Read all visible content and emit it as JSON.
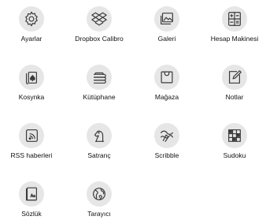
{
  "apps": [
    {
      "label": "Ayarlar",
      "icon": "gear-icon"
    },
    {
      "label": "Dropbox Calibro",
      "icon": "dropbox-icon"
    },
    {
      "label": "Galeri",
      "icon": "gallery-icon"
    },
    {
      "label": "Hesap Makinesi",
      "icon": "calculator-icon"
    },
    {
      "label": "Kosynka",
      "icon": "cards-icon"
    },
    {
      "label": "Kütüphane",
      "icon": "library-icon"
    },
    {
      "label": "Mağaza",
      "icon": "shopping-bag-icon"
    },
    {
      "label": "Notlar",
      "icon": "notepad-icon"
    },
    {
      "label": "RSS haberleri",
      "icon": "rss-icon"
    },
    {
      "label": "Satranç",
      "icon": "chess-knight-icon"
    },
    {
      "label": "Scribble",
      "icon": "scribble-icon"
    },
    {
      "label": "Sudoku",
      "icon": "sudoku-icon"
    },
    {
      "label": "Sözlük",
      "icon": "dictionary-icon"
    },
    {
      "label": "Tarayıcı",
      "icon": "globe-icon"
    }
  ]
}
